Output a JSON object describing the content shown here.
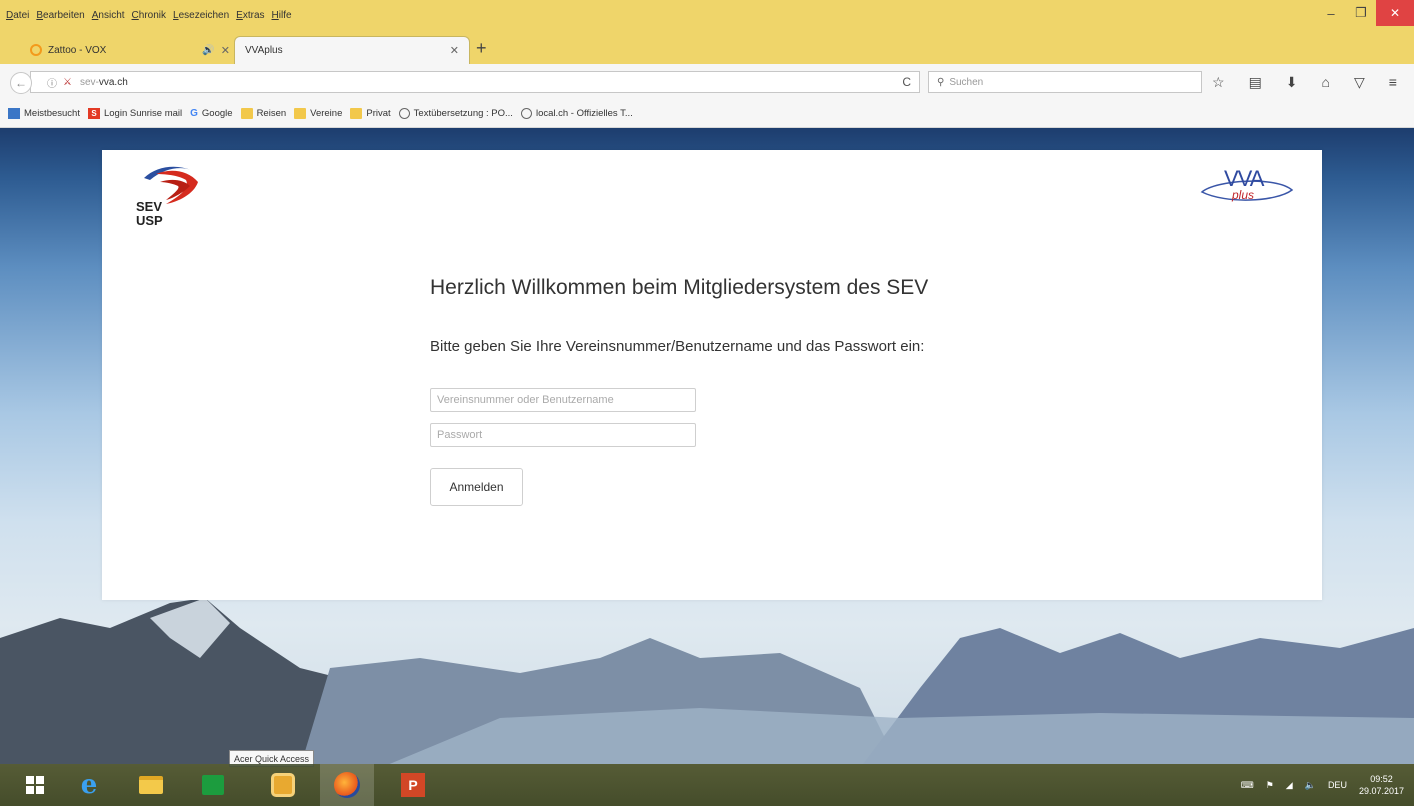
{
  "menubar": {
    "items": [
      "Datei",
      "Bearbeiten",
      "Ansicht",
      "Chronik",
      "Lesezeichen",
      "Extras",
      "Hilfe"
    ],
    "window_controls": {
      "minimize": "–",
      "maximize": "❐",
      "close": "✕"
    }
  },
  "tabs": [
    {
      "label": "Zattoo - VOX",
      "active": false,
      "audio_icon": "🔊",
      "close": "✕"
    },
    {
      "label": "VVAplus",
      "active": true,
      "close": "✕"
    }
  ],
  "new_tab_label": "+",
  "navbar": {
    "back": "←",
    "url_gray": "sev-",
    "url_main": "vva.ch",
    "reload": "C",
    "search_placeholder": "Suchen",
    "icons": [
      "star-icon",
      "library-icon",
      "download-icon",
      "home-icon",
      "pocket-icon",
      "menu-icon"
    ]
  },
  "bookmarks": [
    {
      "label": "Meistbesucht",
      "icon": "star"
    },
    {
      "label": "Login Sunrise mail",
      "icon": "sunrise"
    },
    {
      "label": "Google",
      "icon": "google"
    },
    {
      "label": "Reisen",
      "icon": "folder"
    },
    {
      "label": "Vereine",
      "icon": "folder"
    },
    {
      "label": "Privat",
      "icon": "folder"
    },
    {
      "label": "Textübersetzung : PO...",
      "icon": "globe"
    },
    {
      "label": "local.ch - Offizielles T...",
      "icon": "globe"
    }
  ],
  "page": {
    "logo_left": {
      "line1": "SEV",
      "line2": "USP"
    },
    "logo_right": {
      "text": "VVA",
      "script": "plus"
    },
    "welcome": "Herzlich Willkommen beim Mitgliedersystem des SEV",
    "instruction": "Bitte geben Sie Ihre Vereinsnummer/Benutzername und das Passwort ein:",
    "username_placeholder": "Vereinsnummer oder Benutzername",
    "password_placeholder": "Passwort",
    "login_label": "Anmelden"
  },
  "taskbar": {
    "tooltip": "Acer Quick Access",
    "tray_lang": "DEU",
    "time": "09:52",
    "date": "29.07.2017"
  }
}
